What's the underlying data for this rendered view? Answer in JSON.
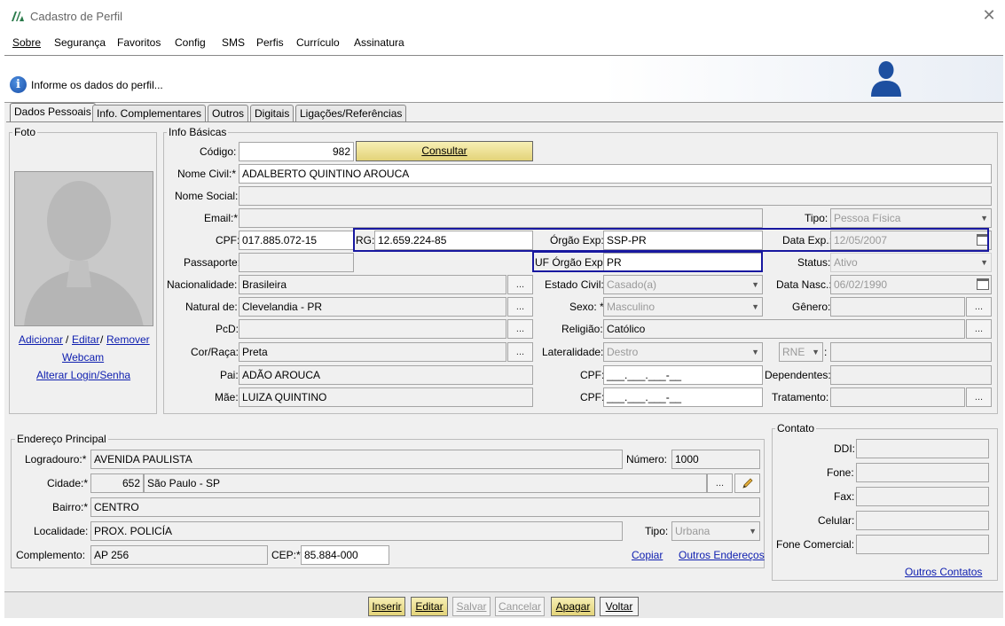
{
  "window": {
    "title": "Cadastro de Perfil"
  },
  "menu": [
    {
      "label": "Sobre"
    },
    {
      "label": "Segurança"
    },
    {
      "label": "Favoritos"
    },
    {
      "label": "Config"
    },
    {
      "label": "SMS"
    },
    {
      "label": "Perfis"
    },
    {
      "label": "Currículo"
    },
    {
      "label": "Assinatura"
    }
  ],
  "banner": {
    "info_text": "Informe os dados do perfil..."
  },
  "tabs": [
    {
      "label": "Dados Pessoais"
    },
    {
      "label": "Info. Complementares"
    },
    {
      "label": "Outros"
    },
    {
      "label": "Digitais"
    },
    {
      "label": "Ligações/Referências"
    }
  ],
  "photo": {
    "title": "Foto",
    "add": "Adicionar",
    "edit": "Editar",
    "remove": "Remover",
    "sep": "/",
    "webcam": "Webcam",
    "alter_login": "Alterar Login/Senha"
  },
  "info": {
    "title": "Info Básicas",
    "codigo_label": "Código:",
    "codigo": "982",
    "consultar": "Consultar",
    "nome_civil_label": "Nome Civil:*",
    "nome_civil": "ADALBERTO QUINTINO AROUCA",
    "nome_social_label": "Nome Social:",
    "nome_social": "",
    "email_label": "Email:*",
    "email": "",
    "tipo_label": "Tipo:",
    "tipo": "Pessoa Física",
    "cpf_label": "CPF:",
    "cpf": "017.885.072-15",
    "rg_label": "RG:",
    "rg": "12.659.224-85",
    "orgao_label": "Órgão Exp:",
    "orgao": "SSP-PR",
    "data_exp_label": "Data Exp.:",
    "data_exp": "12/05/2007",
    "passaporte_label": "Passaporte:",
    "passaporte": "",
    "uf_orgao_label": "UF Órgão Exp:",
    "uf_orgao": "PR",
    "status_label": "Status:",
    "status": "Ativo",
    "nacionalidade_label": "Nacionalidade:",
    "nacionalidade": "Brasileira",
    "estado_civil_label": "Estado Civil:",
    "estado_civil": "Casado(a)",
    "data_nasc_label": "Data Nasc.:",
    "data_nasc": "06/02/1990",
    "natural_label": "Natural de:",
    "natural": "Clevelandia - PR",
    "sexo_label": "Sexo: *",
    "sexo": "Masculino",
    "genero_label": "Gênero:",
    "genero": "",
    "pcd_label": "PcD:",
    "pcd": "",
    "religiao_label": "Religião:",
    "religiao": "Católico",
    "cor_label": "Cor/Raça:",
    "cor": "Preta",
    "lateralidade_label": "Lateralidade:",
    "lateralidade": "Destro",
    "rne": "RNE",
    "rne_colon": ":",
    "pai_label": "Pai:",
    "pai": "ADÃO AROUCA",
    "cpf_pai_label": "CPF:",
    "cpf_pai": "___.___.___-__",
    "dependentes_label": "Dependentes:",
    "mae_label": "Mãe:",
    "mae": "LUIZA QUINTINO",
    "cpf_mae_label": "CPF:",
    "cpf_mae": "___.___.___-__",
    "tratamento_label": "Tratamento:",
    "dots": "..."
  },
  "endereco": {
    "title": "Endereço Principal",
    "logradouro_label": "Logradouro:*",
    "logradouro": "AVENIDA PAULISTA",
    "numero_label": "Número:",
    "numero": "1000",
    "cidade_label": "Cidade:*",
    "cidade_code": "652",
    "cidade": "São Paulo - SP",
    "bairro_label": "Bairro:*",
    "bairro": "CENTRO",
    "localidade_label": "Localidade:",
    "localidade": "PROX. POLICÍA",
    "tipo_label": "Tipo:",
    "tipo": "Urbana",
    "complemento_label": "Complemento:",
    "complemento": "AP 256",
    "cep_label": "CEP:*",
    "cep": "85.884-000",
    "copiar": "Copiar",
    "outros_enderecos": "Outros Endereços"
  },
  "contato": {
    "title": "Contato",
    "ddi_label": "DDI:",
    "fone_label": "Fone:",
    "fax_label": "Fax:",
    "celular_label": "Celular:",
    "fone_comercial_label": "Fone Comercial:",
    "outros_contatos": "Outros Contatos"
  },
  "buttons": {
    "inserir": "Inserir",
    "editar": "Editar",
    "salvar": "Salvar",
    "cancelar": "Cancelar",
    "apagar": "Apagar",
    "voltar": "Voltar"
  },
  "colors": {
    "highlight": "#1818a0",
    "link": "#1020b0",
    "button_gold": "#e3d379"
  }
}
